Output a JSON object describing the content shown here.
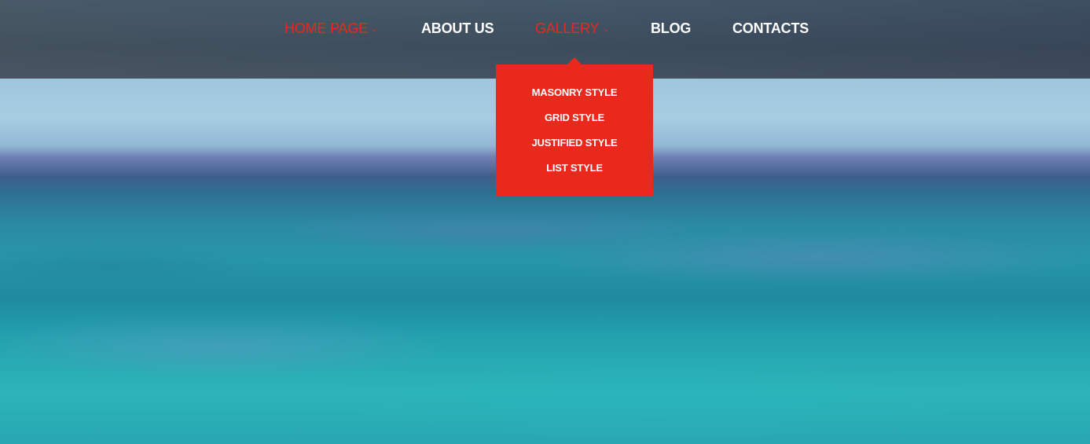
{
  "nav": {
    "items": [
      {
        "label": "HOME PAGE",
        "chevron": "⌄",
        "active": true
      },
      {
        "label": "ABOUT US"
      },
      {
        "label": "GALLERY",
        "chevron": "⌄",
        "active": true
      },
      {
        "label": "BLOG"
      },
      {
        "label": "CONTACTS"
      }
    ]
  },
  "gallery_dropdown": {
    "items": [
      "MASONRY STYLE",
      "GRID STYLE",
      "JUSTIFIED STYLE",
      "LIST STYLE"
    ]
  },
  "colors": {
    "accent": "#e8291c",
    "nav_text": "#ffffff"
  },
  "icons": {
    "home_chevron": "chevron-down-icon",
    "gallery_chevron": "chevron-down-icon"
  }
}
